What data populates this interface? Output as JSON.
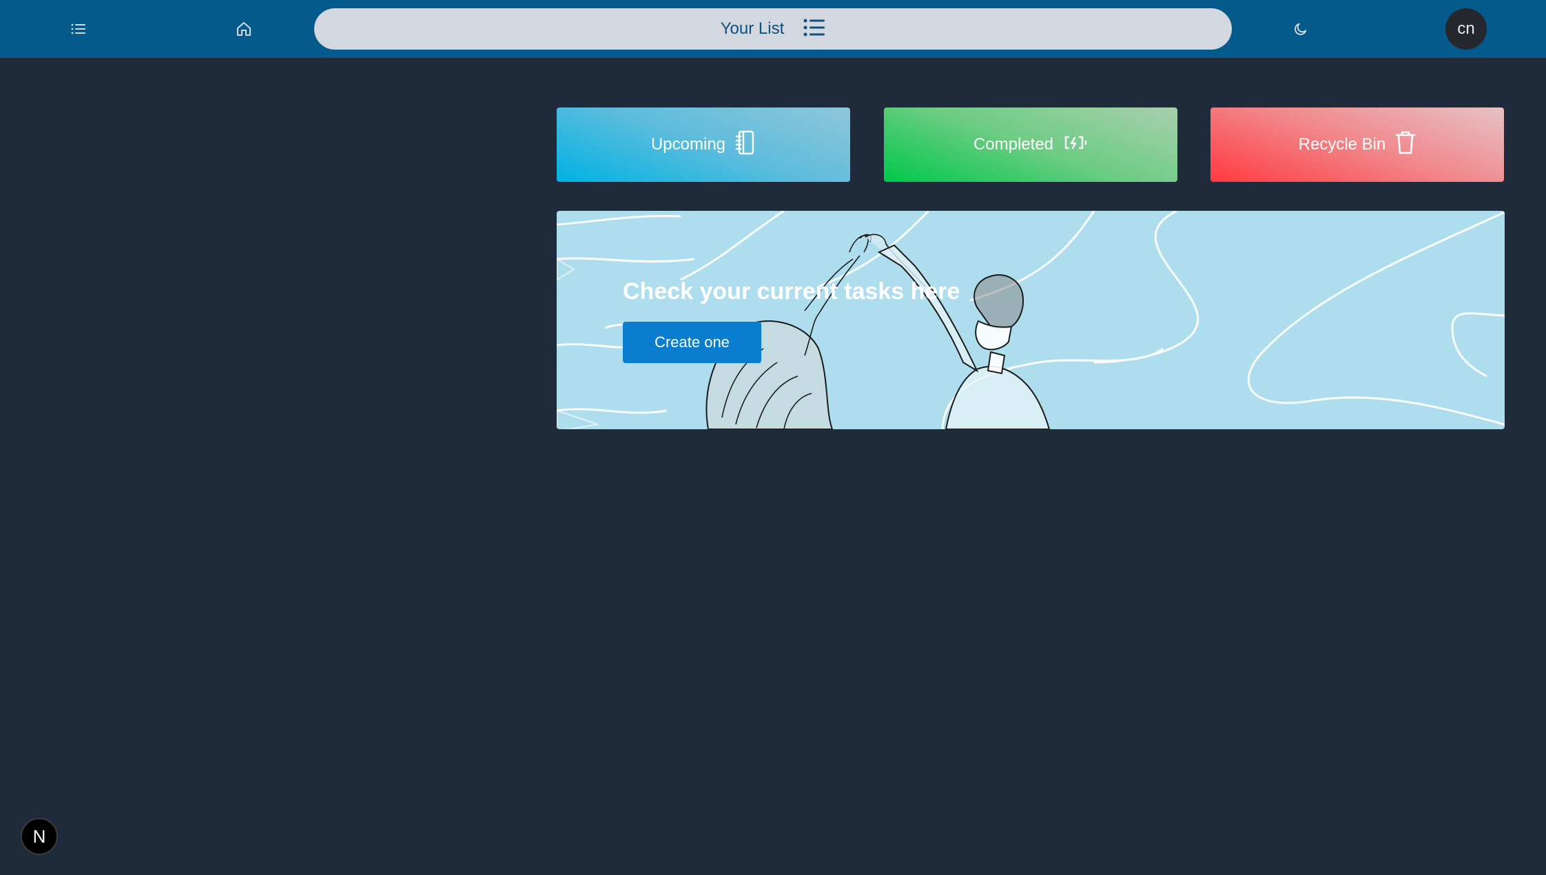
{
  "header": {
    "title": "Your List",
    "avatar_initials": "cn",
    "icons": [
      "list-menu-icon",
      "home-icon",
      "list-icon",
      "moon-icon"
    ]
  },
  "cards": [
    {
      "label": "Upcoming",
      "icon": "notebook-icon",
      "color": "#00b2e3"
    },
    {
      "label": "Completed",
      "icon": "battery-charging-icon",
      "color": "#00c84a"
    },
    {
      "label": "Recycle Bin",
      "icon": "trash-icon",
      "color": "#ff3a3f"
    }
  ],
  "banner": {
    "heading": "Check your current tasks here",
    "button_label": "Create one",
    "background": "#aedeed"
  },
  "badge": {
    "label": "N"
  },
  "colors": {
    "topbar": "#055a8c",
    "page_bg": "#1f2a3b",
    "button_blue": "#0b7dcf"
  }
}
